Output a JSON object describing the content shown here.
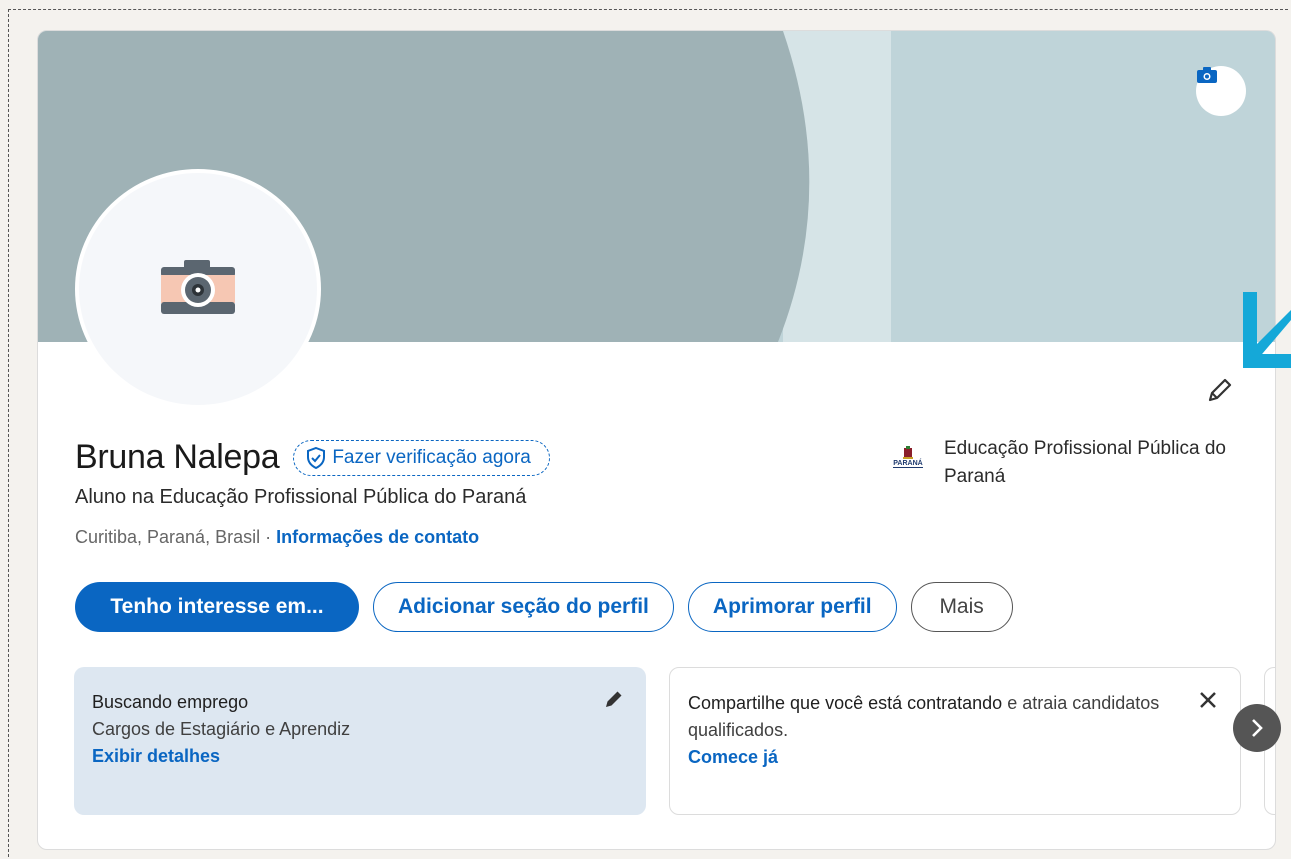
{
  "profile": {
    "name": "Bruna Nalepa",
    "verify_label": "Fazer verificação agora",
    "headline": "Aluno na Educação Profissional Pública do Paraná",
    "location": "Curitiba, Paraná, Brasil",
    "separator": " · ",
    "contact_link": "Informações de contato"
  },
  "organization": {
    "name": "Educação Profissional Pública do Paraná",
    "logo_text": "PARANÁ"
  },
  "actions": {
    "open_to": "Tenho interesse em...",
    "add_section": "Adicionar seção do perfil",
    "enhance": "Aprimorar perfil",
    "more": "Mais"
  },
  "cards": {
    "job": {
      "title": "Buscando emprego",
      "subtitle": "Cargos de Estagiário e Aprendiz",
      "link": "Exibir detalhes"
    },
    "hiring": {
      "title_bold": "Compartilhe que você está contratando",
      "title_rest": " e atraia candidatos qualificados.",
      "link": "Comece já"
    }
  },
  "colors": {
    "accent": "#0a66c2",
    "cover_dark": "#9fb2b6",
    "cover_light": "#bfd4d9",
    "job_card_bg": "#dde7f1",
    "arrow": "#15a8d8"
  },
  "icons": {
    "cover_camera": "camera-icon",
    "avatar": "camera-placeholder-icon",
    "edit": "pencil-icon",
    "verify": "shield-check-icon",
    "close": "close-icon",
    "next": "chevron-right-icon",
    "annotation": "arrow-down-left-icon"
  }
}
